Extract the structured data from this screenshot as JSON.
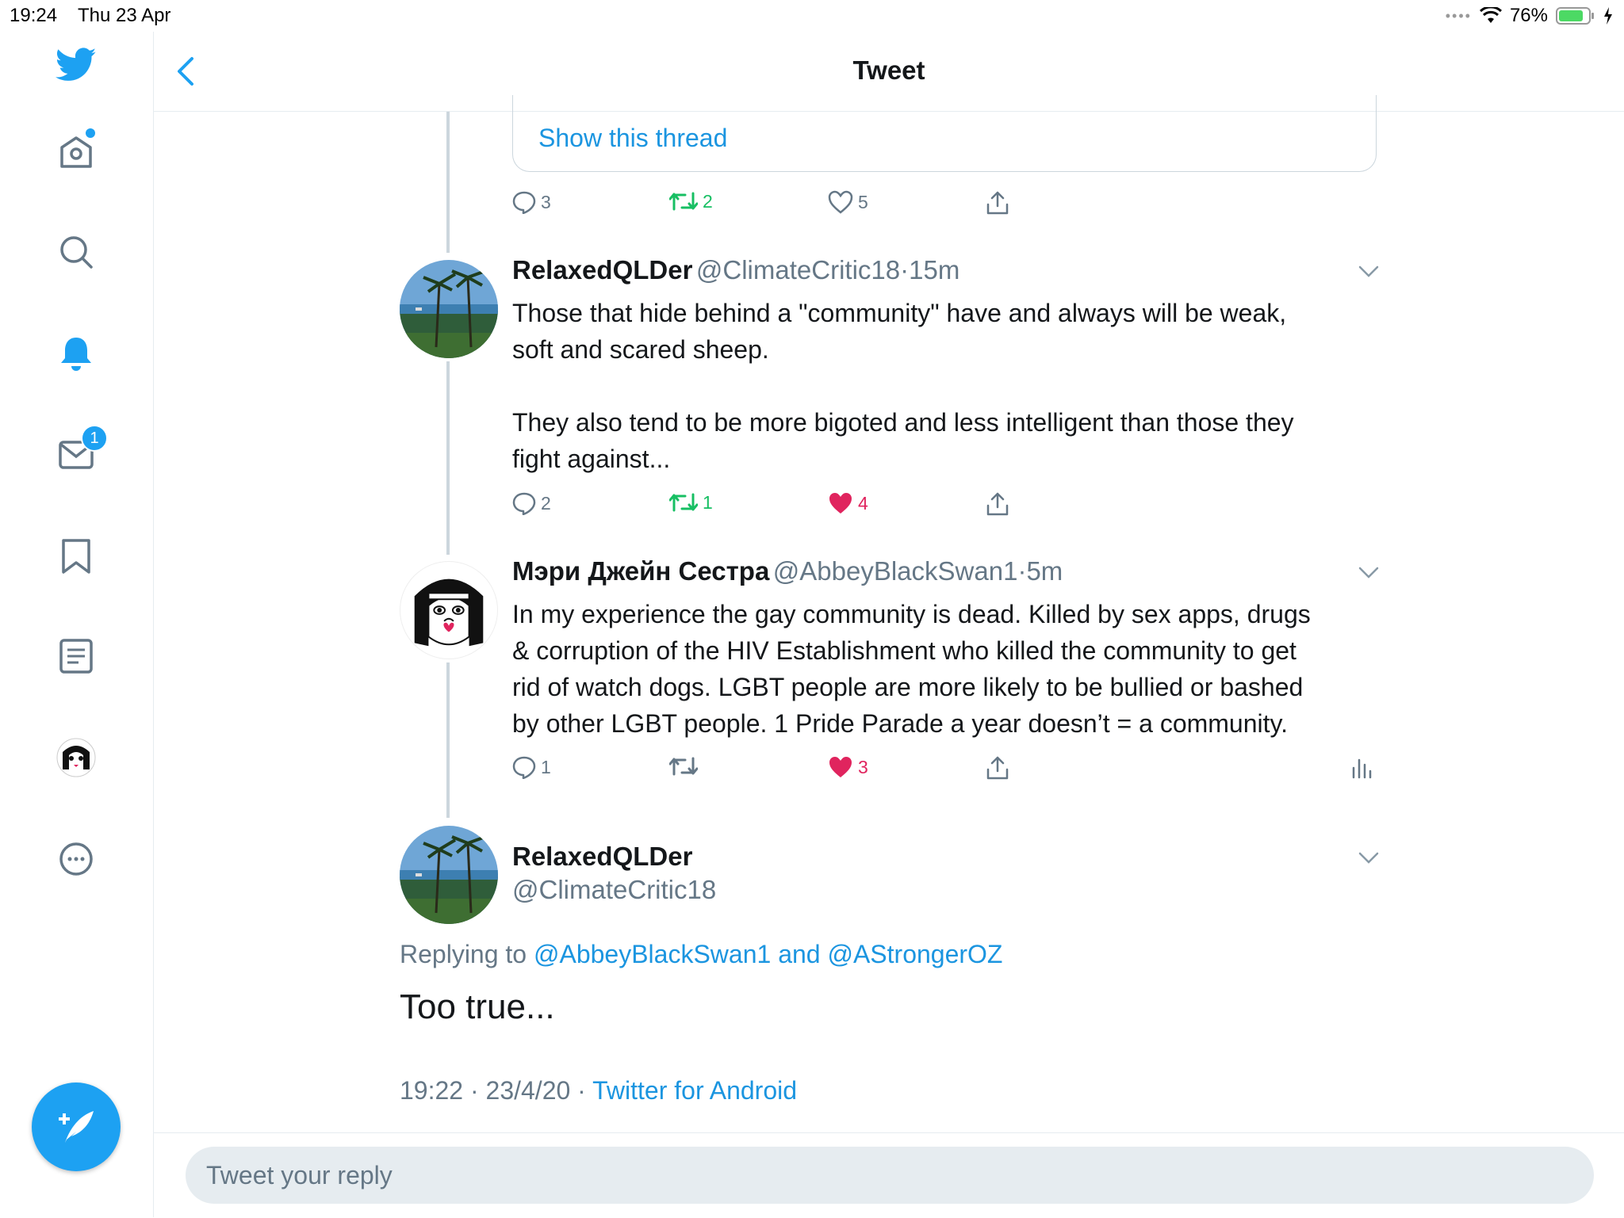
{
  "status_bar": {
    "time": "19:24",
    "date": "Thu 23 Apr",
    "battery": "76%"
  },
  "sidebar": {
    "messages_badge": "1"
  },
  "header": {
    "title": "Tweet"
  },
  "quote": {
    "show_thread": "Show this thread"
  },
  "prev_actions": {
    "replies": "3",
    "retweets": "2",
    "likes": "5"
  },
  "tweet1": {
    "name": "RelaxedQLDer",
    "handle": "@ClimateCritic18",
    "dot": "·",
    "time": "15m",
    "line1": "Those that hide behind a \"community\" have and always will be weak,",
    "line2": "soft and scared sheep.",
    "line3": "They also tend to be more bigoted and less intelligent than those they",
    "line4": "fight against...",
    "replies": "2",
    "retweets": "1",
    "likes": "4"
  },
  "tweet2": {
    "name": "Мэри Джейн Сестра",
    "handle": "@AbbeyBlackSwan1",
    "dot": "·",
    "time": "5m",
    "line1": "In my experience the gay community is dead. Killed by sex apps, drugs",
    "line2": "& corruption of the HIV Establishment who killed the community to get",
    "line3": "rid of watch dogs. LGBT people are more likely to be bullied or bashed",
    "line4": "by other LGBT people. 1 Pride Parade a year doesn’t = a community.",
    "replies": "1",
    "likes": "3"
  },
  "main_tweet": {
    "name": "RelaxedQLDer",
    "handle": "@ClimateCritic18",
    "replying_prefix": "Replying to",
    "replying_to": "@AbbeyBlackSwan1 and @AStrongerOZ",
    "text": "Too true...",
    "timestamp": "19:22 · 23/4/20 ·",
    "source": "Twitter for Android"
  },
  "reply": {
    "placeholder": "Tweet your reply"
  },
  "colors": {
    "accent": "#1da1f2",
    "retweet": "#17bf63",
    "like": "#e0245e",
    "muted": "#657786"
  }
}
